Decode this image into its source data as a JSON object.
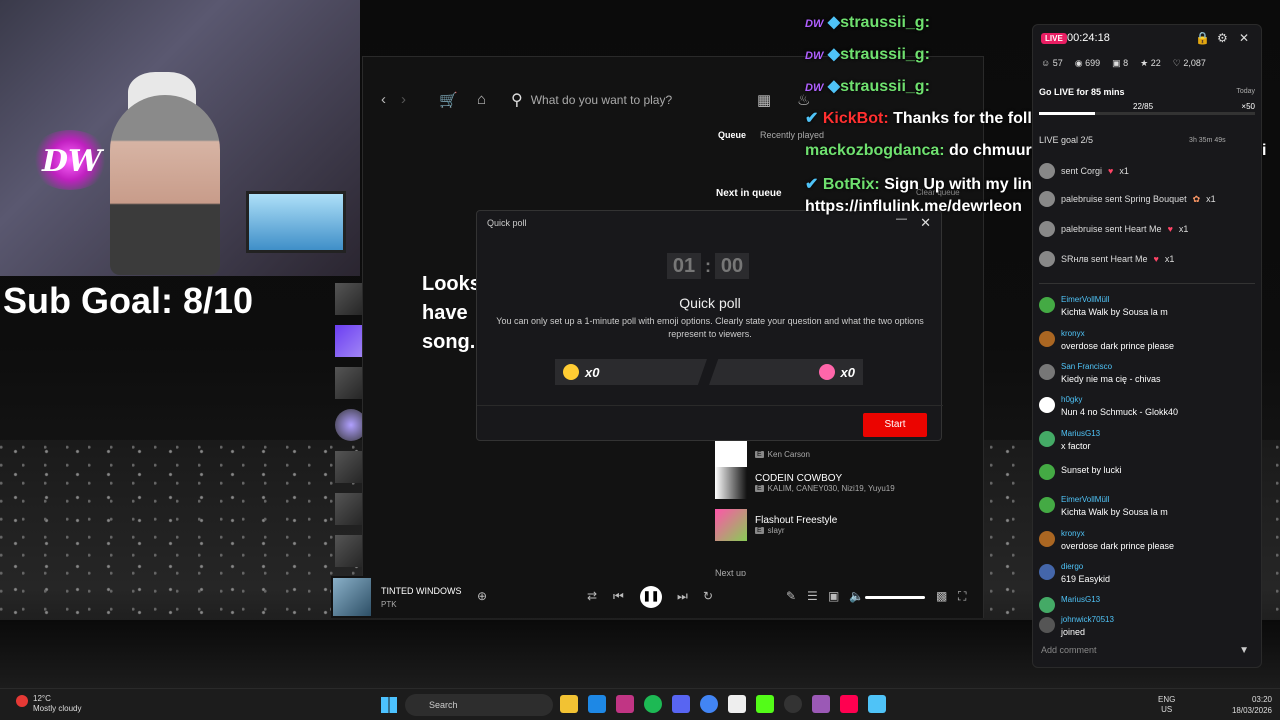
{
  "overlay": {
    "sub_goal": "Sub Goal: 8/10"
  },
  "spotify": {
    "search_placeholder": "What do you want to play?",
    "empty_text": "Looks\nhave\nsong.",
    "queue": {
      "tab_queue": "Queue",
      "tab_recent": "Recently played",
      "next_in_queue": "Next in queue",
      "clear_queue": "Clear queue",
      "tracks": [
        {
          "title": "",
          "artist": "Ken Carson"
        },
        {
          "title": "CODEIN COWBOY",
          "artist": "KALIM, CANEY030, Nizi19, Yuyu19"
        },
        {
          "title": "Flashout Freestyle",
          "artist": "slayr"
        }
      ],
      "next_up": "Next up"
    },
    "player": {
      "title": "TINTED WINDOWS",
      "artist": "PTK"
    }
  },
  "poll": {
    "window_title": "Quick poll",
    "timer_min": "01",
    "timer_sec": "00",
    "title": "Quick poll",
    "description": "You can only set up a 1-minute poll with emoji options. Clearly state your question and what the two options represent to viewers.",
    "option_left_count": "x0",
    "option_right_count": "x0",
    "start_label": "Start"
  },
  "chat_overlay": [
    {
      "user": "straussii_g:",
      "text": ""
    },
    {
      "user": "straussii_g:",
      "text": ""
    },
    {
      "user": "straussii_g:",
      "text": ""
    },
    {
      "user": "KickBot:",
      "text": "Thanks for the follow @mackozbogdanca"
    },
    {
      "user": "mackozbogdanca:",
      "text": "do chmuura ego top or fiołkowe soczewki"
    },
    {
      "user": "BotRix:",
      "text": "Sign Up with my link and depo for bonuses!"
    },
    {
      "user": "",
      "text": "https://influlink.me/dewrleon"
    }
  ],
  "stream_panel": {
    "live_badge": "LIVE",
    "time": "00:24:18",
    "stats": {
      "followers": "57",
      "views": "699",
      "gifts": "8",
      "subs": "22",
      "likes": "2,087"
    },
    "go_live": "Go LIVE for 85 mins",
    "today": "Today",
    "progress_text": "22/85",
    "progress_mult": "×50",
    "progress_fraction": 0.26,
    "live_goal": "LIVE goal 2/5",
    "live_goal_time": "3h 35m 49s",
    "alerts": [
      {
        "text": "sent Corgi",
        "count": "x1"
      },
      {
        "text": "palebruise sent Spring Bouquet",
        "count": "x1"
      },
      {
        "text": "palebruise sent Heart Me",
        "count": "x1"
      },
      {
        "text": "SRнлв sent Heart Me",
        "count": "x1"
      }
    ],
    "messages": [
      {
        "user": "EimerVollMüll",
        "text": "Kichta Walk by Sousa la m"
      },
      {
        "user": "kronyx",
        "text": "overdose dark prince please"
      },
      {
        "user": "San Francisco",
        "text": "Kiedy nie ma cię - chivas"
      },
      {
        "user": "h0gky",
        "text": "Nun 4 no Schmuck - Glokk40"
      },
      {
        "user": "MariusG13",
        "text": "x factor"
      },
      {
        "user": "",
        "text": "Sunset by lucki"
      },
      {
        "user": "EimerVollMüll",
        "text": "Kichta Walk by Sousa la m"
      },
      {
        "user": "kronyx",
        "text": "overdose dark prince please"
      },
      {
        "user": "diergo",
        "text": "619 Easykid"
      },
      {
        "user": "MariusG13",
        "text": ""
      },
      {
        "user": "johnwick70513",
        "text": "joined"
      }
    ],
    "add_comment": "Add comment"
  },
  "taskbar": {
    "weather_temp": "12°C",
    "weather_desc": "Mostly cloudy",
    "search": "Search",
    "lang1": "ENG",
    "lang2": "US",
    "clock": "03:20",
    "date": "18/03/2026"
  }
}
